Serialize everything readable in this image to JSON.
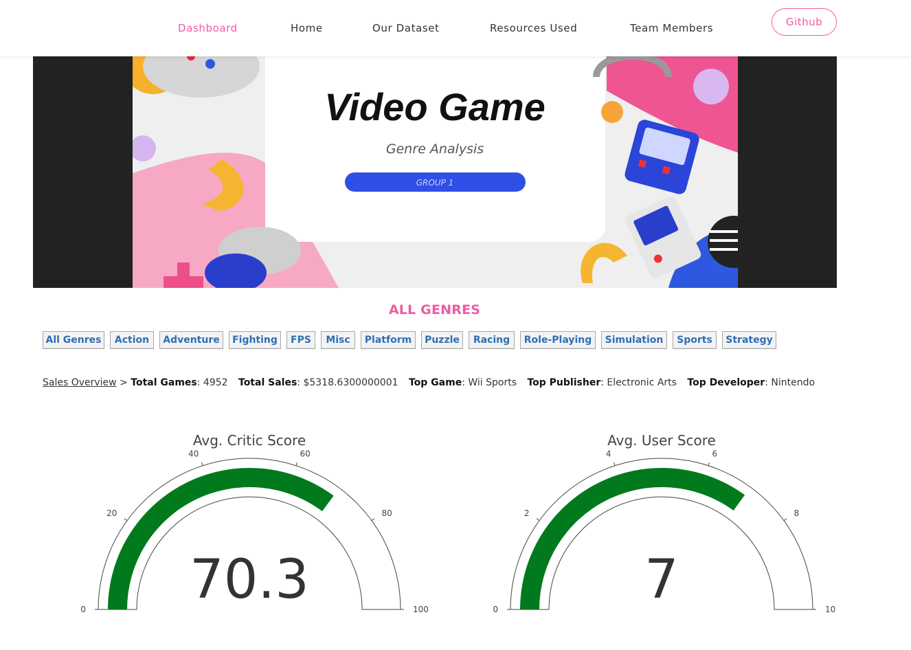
{
  "nav": {
    "items": [
      {
        "label": "Dashboard",
        "active": true
      },
      {
        "label": "Home"
      },
      {
        "label": "Our Dataset"
      },
      {
        "label": "Resources Used"
      },
      {
        "label": "Team Members"
      }
    ],
    "github_label": "Github"
  },
  "banner": {
    "title": "Video Game",
    "subtitle": "Genre Analysis",
    "badge": "GROUP 1"
  },
  "genres": {
    "heading": "ALL GENRES",
    "buttons": [
      "All Genres",
      "Action",
      "Adventure",
      "Fighting",
      "FPS",
      "Misc",
      "Platform",
      "Puzzle",
      "Racing",
      "Role-Playing",
      "Simulation",
      "Sports",
      "Strategy"
    ]
  },
  "summary": {
    "link": "Sales Overview",
    "separator": ">",
    "total_games_label": "Total Games",
    "total_games_value": ": 4952",
    "total_sales_label": "Total Sales",
    "total_sales_value": ": $5318.6300000001",
    "top_game_label": "Top Game",
    "top_game_value": ": Wii Sports",
    "top_publisher_label": "Top Publisher",
    "top_publisher_value": ": Electronic Arts",
    "top_developer_label": "Top Developer",
    "top_developer_value": ": Nintendo"
  },
  "chart_data": [
    {
      "type": "gauge",
      "title": "Avg. Critic Score",
      "value": 70.3,
      "value_label": "70.3",
      "range": [
        0,
        100
      ],
      "ticks": [
        0,
        20,
        40,
        60,
        80,
        100
      ],
      "bar_color": "#007a1c"
    },
    {
      "type": "gauge",
      "title": "Avg. User Score",
      "value": 7,
      "value_label": "7",
      "range": [
        0,
        10
      ],
      "ticks": [
        0,
        2,
        4,
        6,
        8,
        10
      ],
      "bar_color": "#007a1c"
    }
  ]
}
